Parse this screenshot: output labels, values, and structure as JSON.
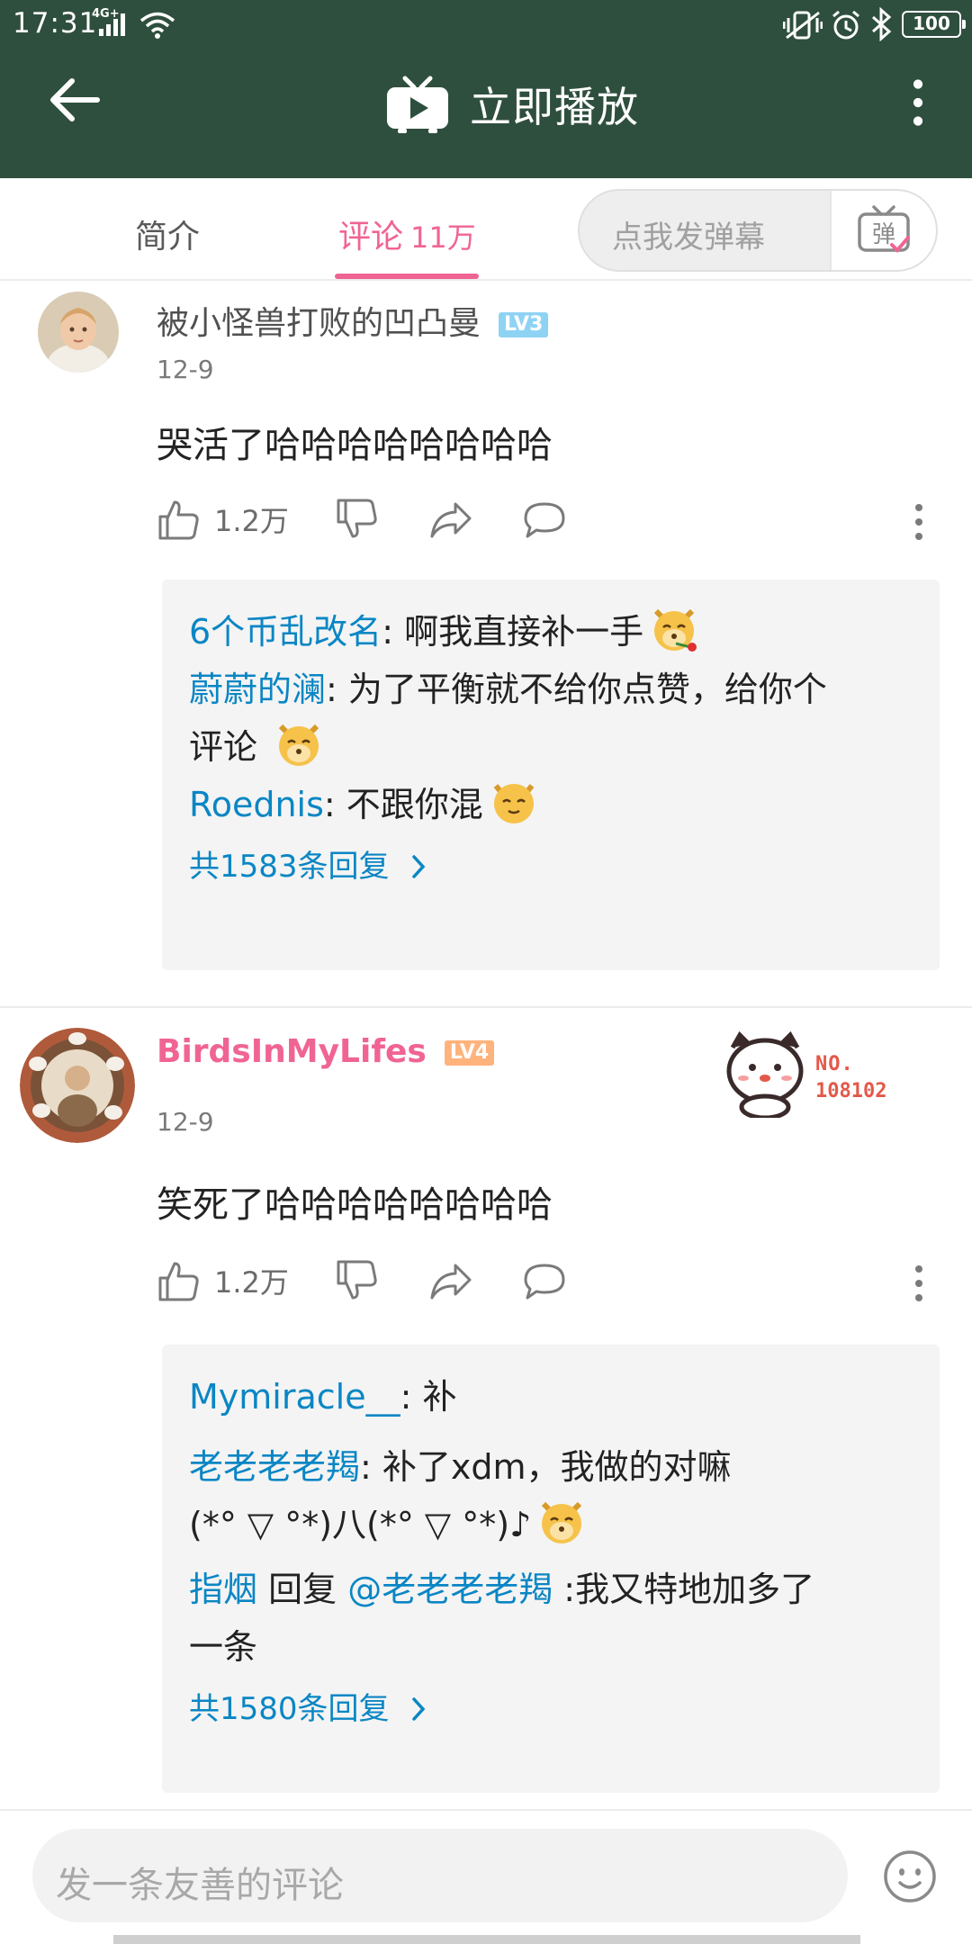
{
  "status_bar": {
    "time": "17:31",
    "network": "4G+",
    "battery": "100"
  },
  "header": {
    "title": "立即播放"
  },
  "tabs": {
    "intro": "简介",
    "comments": "评论",
    "comment_count": "11万"
  },
  "danmu": {
    "placeholder": "点我发弹幕",
    "button_label": "弹"
  },
  "comments": [
    {
      "user": "被小怪兽打败的凹凸曼",
      "level": "LV3",
      "date": "12-9",
      "text": "哭活了哈哈哈哈哈哈哈哈",
      "likes": "1.2万",
      "replies": [
        {
          "name": "6个币乱改名",
          "sep": ": ",
          "text": "啊我直接补一手"
        },
        {
          "name": "蔚蔚的澜",
          "sep": ": ",
          "text": "为了平衡就不给你点赞，给你个",
          "text2": "评论"
        },
        {
          "name": "Roednis",
          "sep": ": ",
          "text": "不跟你混"
        }
      ],
      "more_replies": "共1583条回复"
    },
    {
      "user": "BirdsInMyLifes",
      "level": "LV4",
      "date": "12-9",
      "text": "笑死了哈哈哈哈哈哈哈哈",
      "likes": "1.2万",
      "medal_no": "NO.",
      "medal_num": "108102",
      "replies": [
        {
          "name": "Mymiracle__",
          "sep": ": ",
          "text": "补"
        },
        {
          "name": "老老老老羯",
          "sep": ": ",
          "text": "补了xdm，我做的对嘛",
          "text2": "(*° ▽ °*)八(*° ▽ °*)♪"
        },
        {
          "name": "指烟",
          "reply_word": " 回复 ",
          "target": "@老老老老羯",
          "text": " :我又特地加多了",
          "text2": "一条"
        }
      ],
      "more_replies": "共1580条回复"
    }
  ],
  "bottom": {
    "placeholder": "发一条友善的评论"
  },
  "colors": {
    "header_green": "#2f4f3e",
    "accent_pink": "#f06493",
    "link_blue": "#0a86c4"
  }
}
